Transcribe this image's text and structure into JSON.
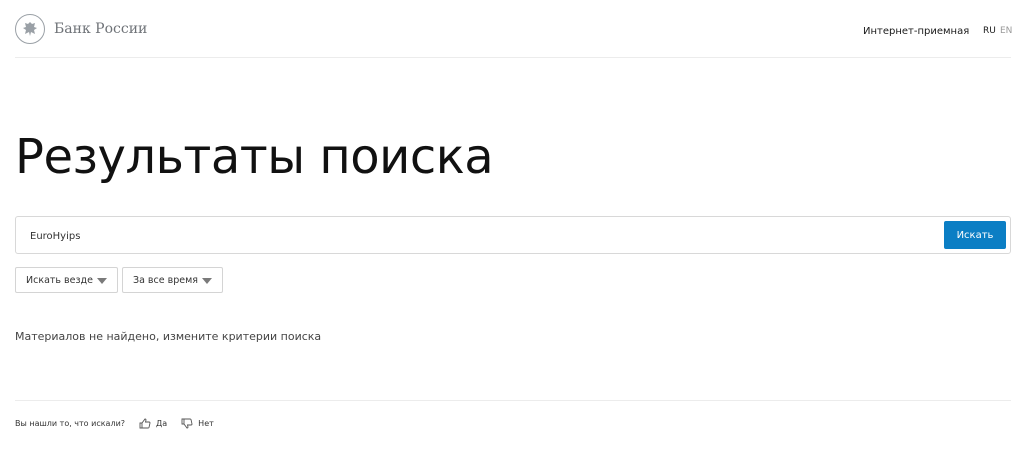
{
  "header": {
    "logo_text": "Банк России",
    "logo_icon": "emblem-icon",
    "reception_link": "Интернет-приемная",
    "lang_ru": "RU",
    "lang_en": "EN"
  },
  "main": {
    "title": "Результаты поиска",
    "search": {
      "value": "EuroHyips",
      "button_label": "Искать"
    },
    "filters": {
      "scope": "Искать везде",
      "period": "За все время"
    },
    "empty_message": "Материалов не найдено, измените критерии поиска"
  },
  "feedback": {
    "question": "Вы нашли то, что искали?",
    "yes_label": "Да",
    "no_label": "Нет"
  },
  "colors": {
    "accent": "#0b7ec4",
    "text": "#1a1a1a",
    "muted": "#9a9a9a"
  }
}
